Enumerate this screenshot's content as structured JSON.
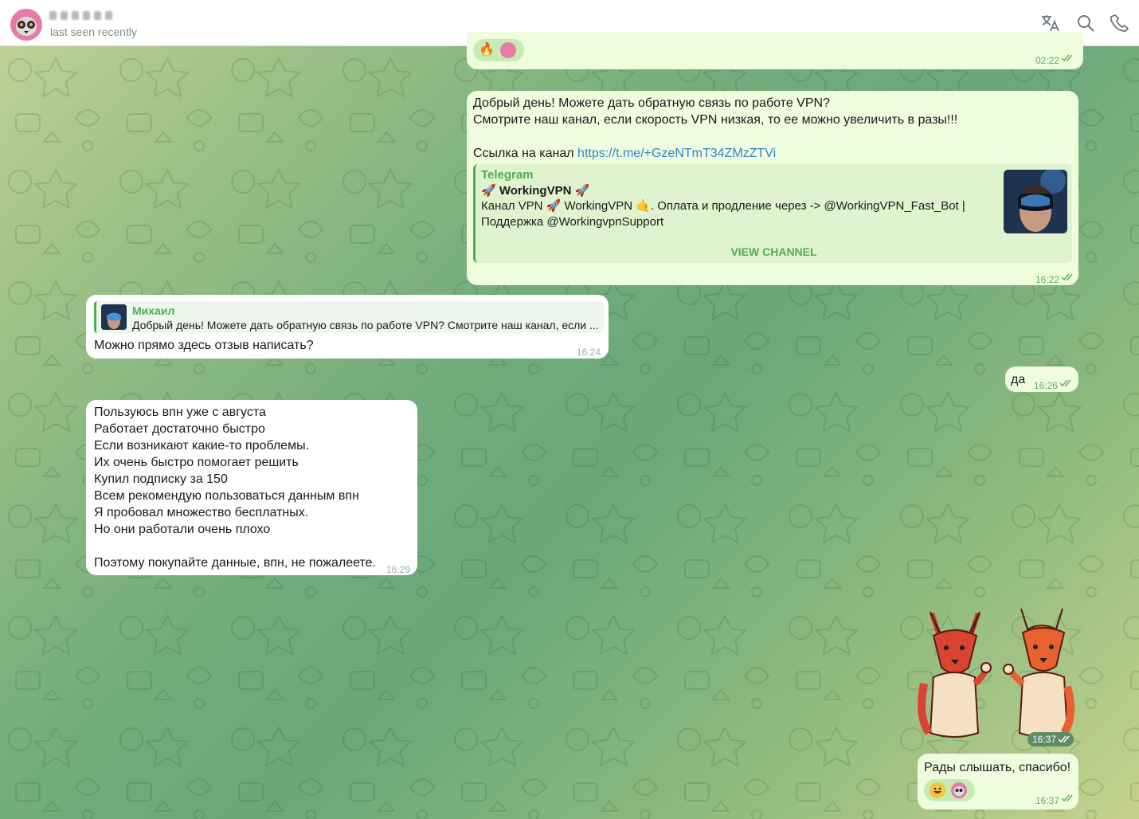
{
  "header": {
    "status": "last seen recently",
    "icons": [
      "translate-icon",
      "search-icon",
      "phone-icon"
    ]
  },
  "messages": {
    "m1": {
      "time": "02:22"
    },
    "m2": {
      "lines": [
        "Добрый день! Можете дать обратную связь по работе VPN?",
        "Смотрите наш канал, если скорость VPN низкая, то ее можно увеличить в разы!!!",
        "",
        "Ссылка на канал"
      ],
      "link": "https://t.me/+GzeNTmT34ZMzZTVi",
      "preview": {
        "site": "Telegram",
        "title": "🚀 WorkingVPN 🚀",
        "desc_1": "Канал VPN 🚀 WorkingVPN 🤙. Оплата и продление через -> @WorkingVPN_Fast_Bot |",
        "desc_2": "Поддержка @WorkingvpnSupport",
        "button": "VIEW CHANNEL"
      },
      "time": "16:22"
    },
    "m3": {
      "reply_name": "Михаил",
      "reply_text": "Добрый день! Можете дать обратную связь по работе VPN? Смотрите наш канал, если ...",
      "text": "Можно прямо здесь отзыв написать?",
      "time": "16:24"
    },
    "m4": {
      "text": "да",
      "time": "16:26"
    },
    "m5": {
      "lines": [
        "Пользуюсь впн уже с августа",
        "Работает достаточно быстро",
        "Если возникают какие-то проблемы.",
        "Их очень быстро помогает решить",
        "Купил подписку за 150",
        "Всем рекомендую пользоваться данным впн",
        "Я пробовал множество бесплатных.",
        "Но они работали очень плохо",
        "",
        "Поэтому покупайте данные, впн, не пожалеете."
      ],
      "time": "16:29"
    },
    "m6": {
      "time": "16:37"
    },
    "m7": {
      "text": "Рады слышать, спасибо!",
      "time": "16:37"
    }
  },
  "colors": {
    "outgoing": "#effdde",
    "incoming": "#ffffff",
    "accent": "#4fae4e",
    "link": "#2e86c9"
  }
}
